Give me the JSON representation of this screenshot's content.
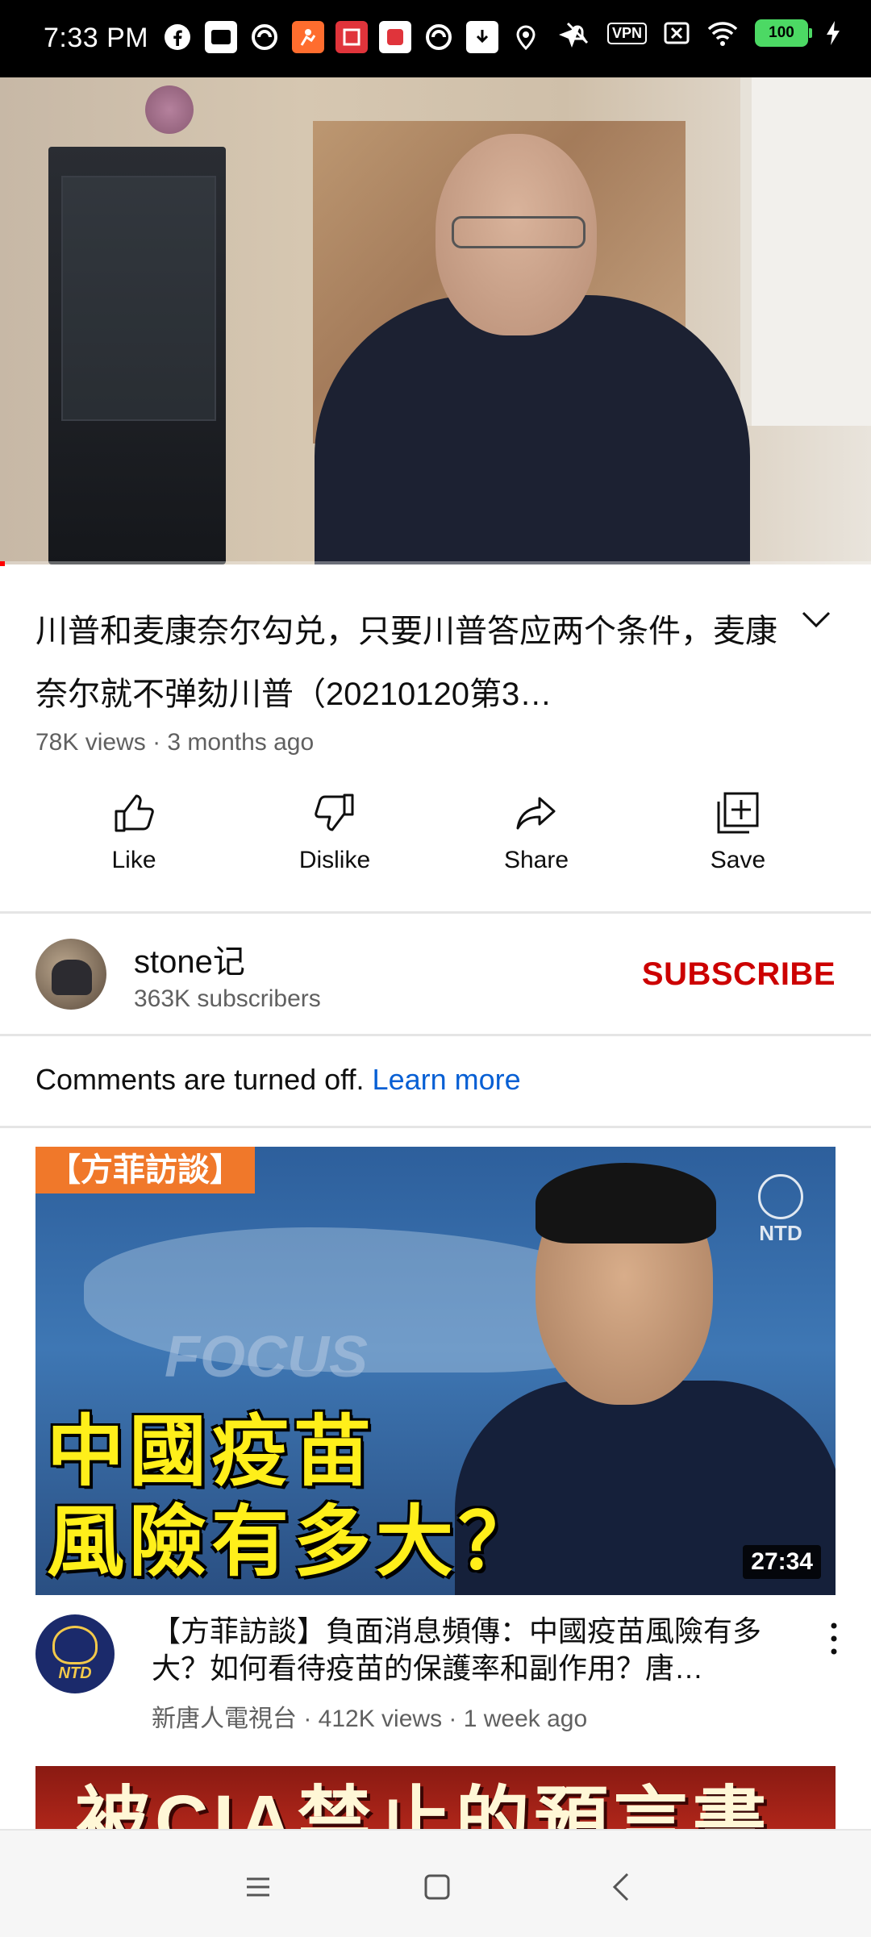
{
  "status_bar": {
    "time": "7:33 PM",
    "vpn": "VPN",
    "battery": "100"
  },
  "video": {
    "title": "川普和麦康奈尔勾兑，只要川普答应两个条件，麦康奈尔就不弹劾川普（20210120第3…",
    "meta": "78K views · 3 months ago",
    "progress_fraction": 0.005
  },
  "actions": {
    "like": "Like",
    "dislike": "Dislike",
    "share": "Share",
    "save": "Save"
  },
  "channel": {
    "name": "stone记",
    "subscribers": "363K subscribers",
    "subscribe_label": "SUBSCRIBE"
  },
  "comments": {
    "text": "Comments are turned off.",
    "link": "Learn more"
  },
  "recommended": [
    {
      "tag": "【方菲訪談】",
      "watermark": "NTD",
      "bg_text": "FOCUS",
      "caption_line1": "中國疫苗",
      "caption_line2": "風險有多大？",
      "duration": "27:34",
      "channel_avatar_label": "NTD",
      "title": "【方菲訪談】負面消息頻傳：中國疫苗風險有多大？如何看待疫苗的保護率和副作用？唐…",
      "meta": "新唐人電視台 · 412K views · 1 week ago"
    },
    {
      "caption": "被CIA禁止的預言書"
    }
  ],
  "colors": {
    "subscribe": "#cc0000",
    "link": "#065fd4",
    "progress": "#ff0000",
    "secondary_text": "#606060"
  }
}
